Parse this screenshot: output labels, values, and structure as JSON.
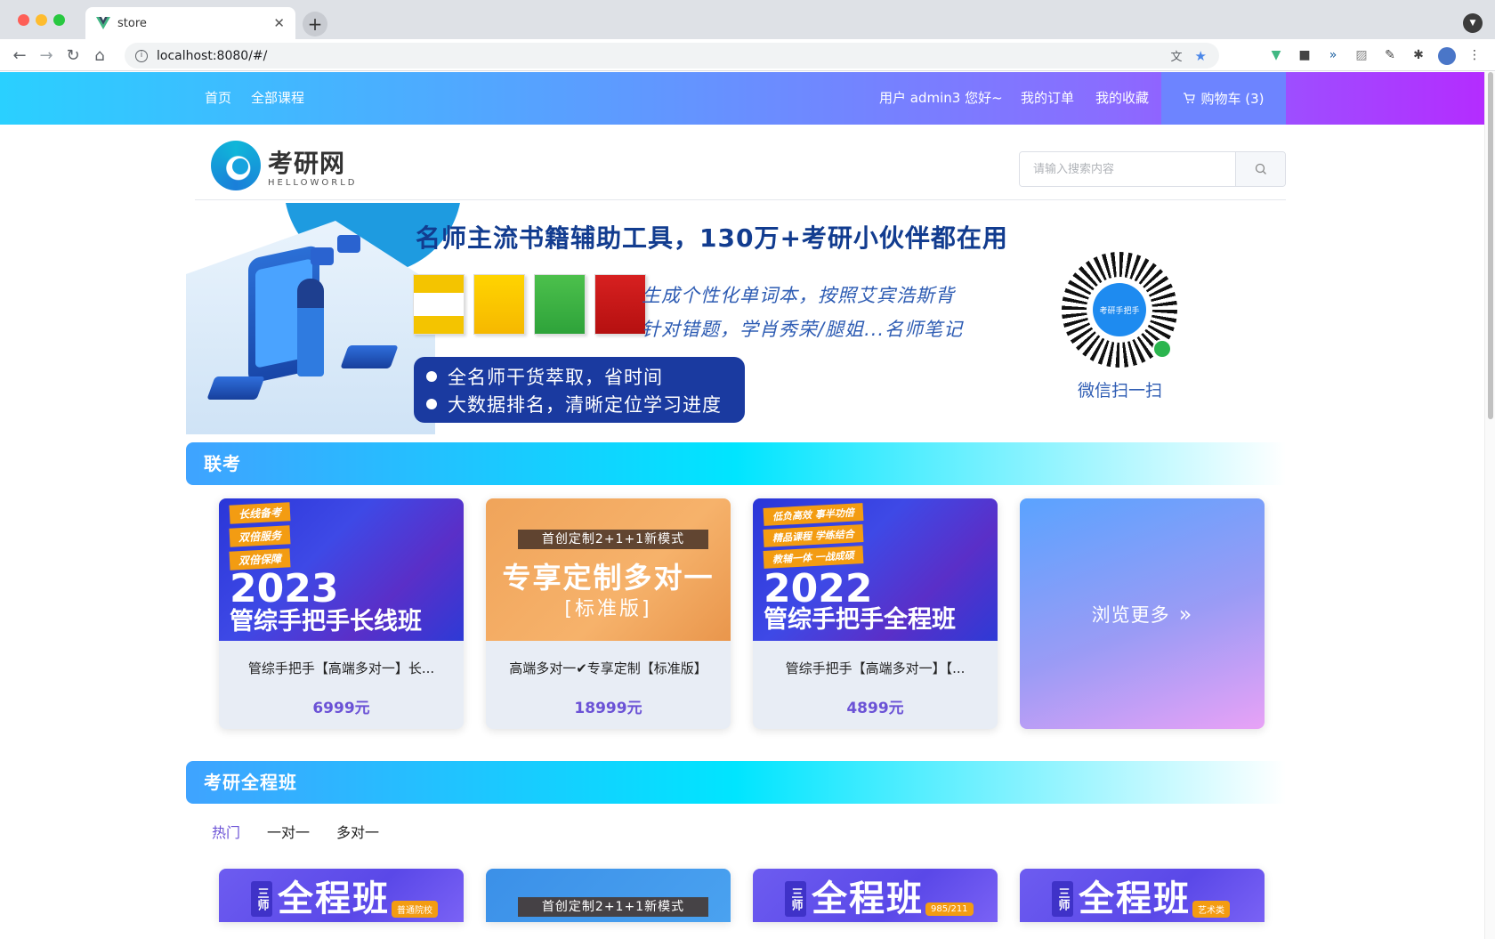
{
  "browser": {
    "tab_title": "store",
    "tab_close": "✕",
    "new_tab": "+",
    "url": "localhost:8080/#/"
  },
  "topnav": {
    "home": "首页",
    "all_courses": "全部课程",
    "greeting": "用户 admin3 您好~",
    "orders": "我的订单",
    "favorites": "我的收藏",
    "cart": "购物车 (3)"
  },
  "header": {
    "logo_title": "考研网",
    "logo_subtitle": "HELLOWORLD",
    "search_placeholder": "请输入搜索内容"
  },
  "banner": {
    "headline": "名师主流书籍辅助工具，130万+考研小伙伴都在用",
    "slogan_1": "生成个性化单词本，按照艾宾浩斯背",
    "slogan_2": "针对错题，学肖秀荣/腿姐...名师笔记",
    "bullet_1": "全名师干货萃取，省时间",
    "bullet_2": "大数据排名，清晰定位学习进度",
    "qr_caption": "微信扫一扫",
    "qr_logo_text": "考研手把手"
  },
  "sections": {
    "liankao": {
      "title": "联考",
      "cards": [
        {
          "tags": [
            "长线备考",
            "双倍服务",
            "双倍保障"
          ],
          "year": "2023",
          "class_name": "管综手把手长线班",
          "name": "管综手把手【高端多对一】长...",
          "price": "6999元"
        },
        {
          "ribbon": "首创定制2+1+1新模式",
          "main": "专享定制多对一",
          "sub": "[标准版]",
          "name": "高端多对一✔专享定制【标准版】",
          "price": "18999元"
        },
        {
          "tags": [
            "低负高效 事半功倍",
            "精品课程 学练结合",
            "教辅一体 一战成硕"
          ],
          "year": "2022",
          "class_name": "管综手把手全程班",
          "name": "管综手把手【高端多对一】【...",
          "price": "4899元"
        }
      ],
      "more": "浏览更多"
    },
    "quancheng": {
      "title": "考研全程班",
      "tabs": [
        "热门",
        "一对一",
        "多对一"
      ],
      "cards": [
        {
          "teacher": "三师",
          "text": "全程班",
          "badge": "普通院校"
        },
        {
          "ribbon": "首创定制2+1+1新模式"
        },
        {
          "teacher": "三师",
          "text": "全程班",
          "badge": "985/211"
        },
        {
          "teacher": "三师",
          "text": "全程班",
          "badge": "艺术类"
        }
      ]
    }
  },
  "colors": {
    "accent": "#6b52d6",
    "nav_gradient_start": "#2ad0ff",
    "nav_gradient_end": "#b42cff"
  }
}
